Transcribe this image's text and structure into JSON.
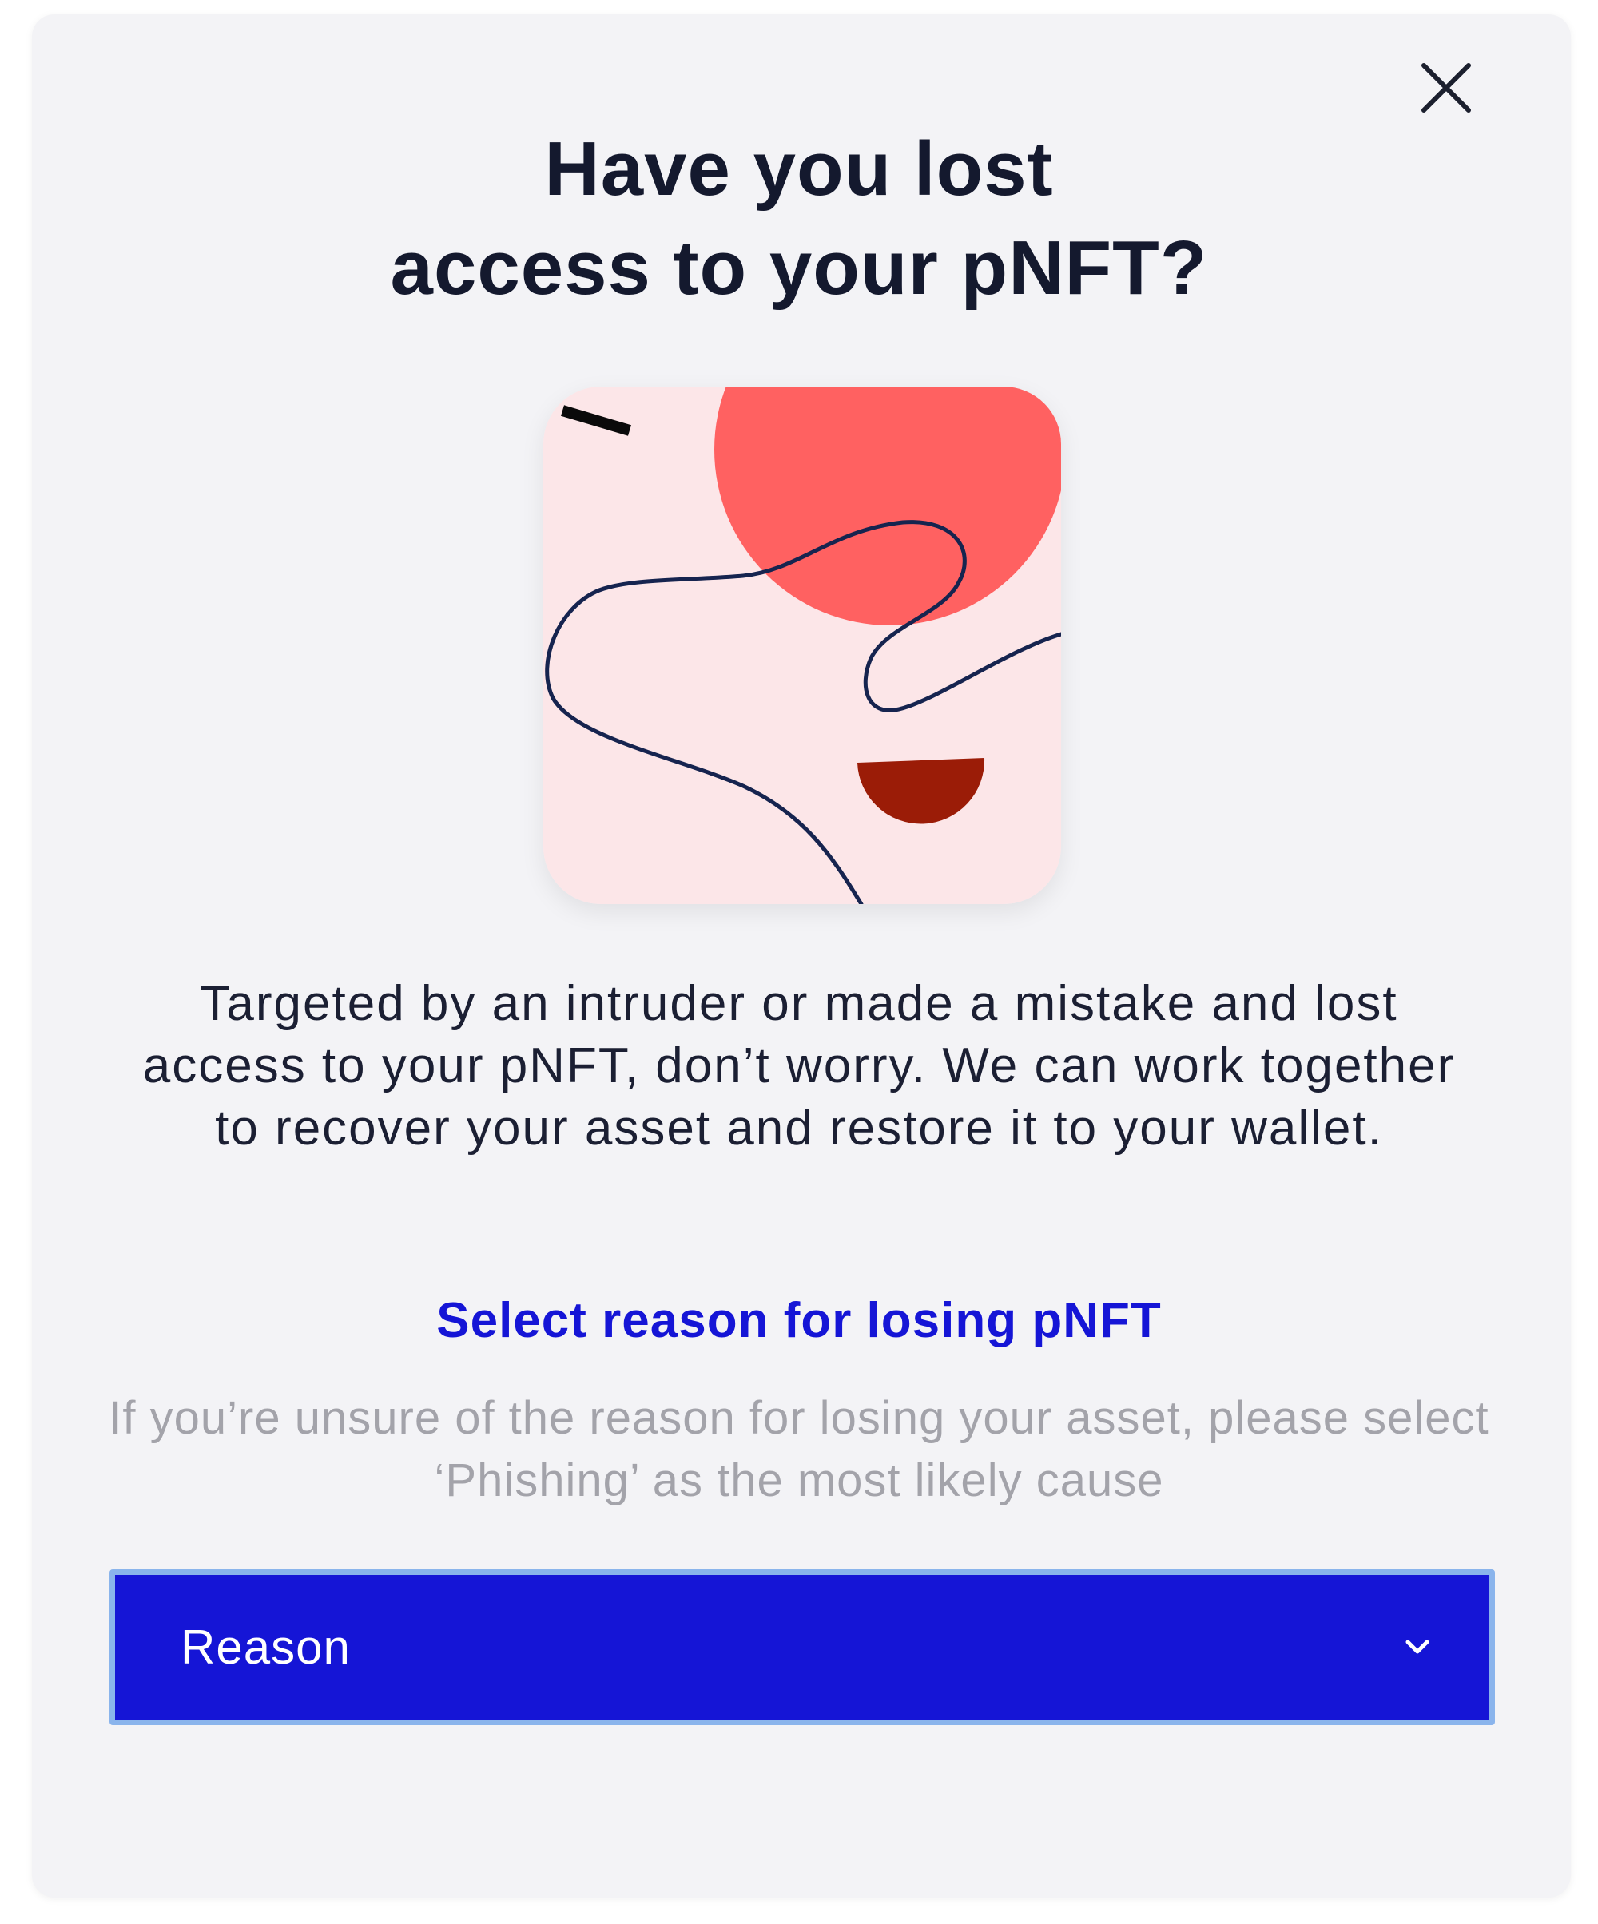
{
  "dialog": {
    "close_icon": "close-icon",
    "title_line1": "Have you lost",
    "title_line2": "access to your pNFT?",
    "artwork": {
      "background": "#fce6e8",
      "circle_color": "#ff6161",
      "semicircle_color": "#9b1c07",
      "line_color": "#16244f",
      "dash_color": "#0a0a0a"
    },
    "description": "Targeted by an intruder or made a mistake and lost access to your pNFT, don’t worry. We can work together to recover your asset and restore it to your wallet.",
    "section_heading": "Select reason for losing pNFT",
    "hint": "If you’re unsure of the reason for losing your asset, please select ‘Phishing’ as the most likely cause",
    "reason_select": {
      "value": "Reason",
      "icon": "chevron-down-icon",
      "background": "#1515d6",
      "focus_ring": "#8ab4ec"
    }
  }
}
